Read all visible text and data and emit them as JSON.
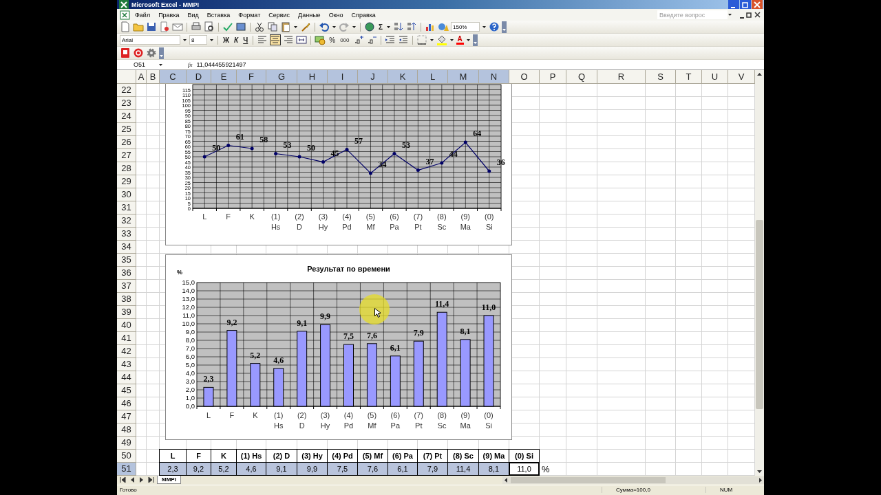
{
  "window": {
    "title": "Microsoft Excel - MMPI"
  },
  "menu": [
    "Файл",
    "Правка",
    "Вид",
    "Вставка",
    "Формат",
    "Сервис",
    "Данные",
    "Окно",
    "Справка"
  ],
  "help_search": {
    "placeholder": "Введите вопрос"
  },
  "toolbar": {
    "sum": "Σ",
    "zoom": "150%",
    "font": "Arial",
    "font_size": "8",
    "bold": "Ж",
    "italic": "К",
    "underline": "Ч",
    "percent": "%",
    "thousands": "000",
    "font_color": "A"
  },
  "formula_bar": {
    "cell": "O51",
    "fx": "fx",
    "value": "11,044455921497"
  },
  "columns": [
    {
      "label": "A",
      "highlighted": false
    },
    {
      "label": "B",
      "highlighted": false
    },
    {
      "label": "C",
      "highlighted": true
    },
    {
      "label": "D",
      "highlighted": true
    },
    {
      "label": "E",
      "highlighted": true
    },
    {
      "label": "F",
      "highlighted": true
    },
    {
      "label": "G",
      "highlighted": true
    },
    {
      "label": "H",
      "highlighted": true
    },
    {
      "label": "I",
      "highlighted": true
    },
    {
      "label": "J",
      "highlighted": true
    },
    {
      "label": "K",
      "highlighted": true
    },
    {
      "label": "L",
      "highlighted": true
    },
    {
      "label": "M",
      "highlighted": true
    },
    {
      "label": "N",
      "highlighted": true
    },
    {
      "label": "O",
      "highlighted": false
    },
    {
      "label": "P",
      "highlighted": false
    },
    {
      "label": "Q",
      "highlighted": false
    },
    {
      "label": "R",
      "highlighted": false
    },
    {
      "label": "S",
      "highlighted": false
    },
    {
      "label": "T",
      "highlighted": false
    },
    {
      "label": "U",
      "highlighted": false
    },
    {
      "label": "V",
      "highlighted": false
    }
  ],
  "rows": [
    {
      "label": "22",
      "highlighted": false
    },
    {
      "label": "23",
      "highlighted": false
    },
    {
      "label": "24",
      "highlighted": false
    },
    {
      "label": "25",
      "highlighted": false
    },
    {
      "label": "26",
      "highlighted": false
    },
    {
      "label": "27",
      "highlighted": false
    },
    {
      "label": "28",
      "highlighted": false
    },
    {
      "label": "29",
      "highlighted": false
    },
    {
      "label": "30",
      "highlighted": false
    },
    {
      "label": "31",
      "highlighted": false
    },
    {
      "label": "32",
      "highlighted": false
    },
    {
      "label": "33",
      "highlighted": false
    },
    {
      "label": "34",
      "highlighted": false
    },
    {
      "label": "35",
      "highlighted": false
    },
    {
      "label": "36",
      "highlighted": false
    },
    {
      "label": "37",
      "highlighted": false
    },
    {
      "label": "38",
      "highlighted": false
    },
    {
      "label": "39",
      "highlighted": false
    },
    {
      "label": "40",
      "highlighted": false
    },
    {
      "label": "41",
      "highlighted": false
    },
    {
      "label": "42",
      "highlighted": false
    },
    {
      "label": "43",
      "highlighted": false
    },
    {
      "label": "44",
      "highlighted": false
    },
    {
      "label": "45",
      "highlighted": false
    },
    {
      "label": "46",
      "highlighted": false
    },
    {
      "label": "47",
      "highlighted": false
    },
    {
      "label": "48",
      "highlighted": false
    },
    {
      "label": "49",
      "highlighted": false
    },
    {
      "label": "50",
      "highlighted": false
    },
    {
      "label": "51",
      "highlighted": true
    }
  ],
  "charts": [
    {
      "chart_data": {
        "type": "line",
        "categories": [
          "L",
          "F",
          "K",
          "(1) Hs",
          "(2) D",
          "(3) Hy",
          "(4) Pd",
          "(5) Mf",
          "(6) Pa",
          "(7) Pt",
          "(8) Sc",
          "(9) Ma",
          "(0) Si"
        ],
        "series": [
          {
            "color": "#000066",
            "values": [
              50,
              61,
              58,
              null,
              null,
              null,
              null,
              null,
              null,
              null,
              null,
              null,
              null
            ]
          },
          {
            "color": "#000066",
            "values": [
              null,
              null,
              null,
              53,
              50,
              45,
              57,
              34,
              53,
              37,
              44,
              64,
              36
            ]
          }
        ],
        "ylim": [
          0,
          120
        ],
        "grid": true,
        "yticks": [
          0,
          5,
          10,
          15,
          20,
          25,
          30,
          35,
          40,
          45,
          50,
          55,
          60,
          65,
          70,
          75,
          80,
          85,
          90,
          95,
          100,
          105,
          110,
          115
        ],
        "value_labels": [
          "50",
          "61",
          "58",
          "53",
          "50",
          "45",
          "57",
          "34",
          "53",
          "37",
          "44",
          "64",
          "36"
        ]
      }
    },
    {
      "chart_data": {
        "type": "bar",
        "title": "Результат по времени",
        "ylabel": "%",
        "categories": [
          "L",
          "F",
          "K",
          "(1) Hs",
          "(2) D",
          "(3) Hy",
          "(4) Pd",
          "(5) Mf",
          "(6) Pa",
          "(7) Pt",
          "(8) Sc",
          "(9) Ma",
          "(0) Si"
        ],
        "series": [
          {
            "color": "#9999ff",
            "values": [
              2.3,
              9.2,
              5.2,
              4.6,
              9.1,
              9.9,
              7.5,
              7.6,
              6.1,
              7.9,
              11.4,
              8.1,
              11.0
            ]
          }
        ],
        "ylim": [
          0,
          15
        ],
        "grid": true,
        "yticks": [
          {
            "value": 0,
            "label": "0,0"
          },
          {
            "value": 1,
            "label": "1,0"
          },
          {
            "value": 2,
            "label": "2,0"
          },
          {
            "value": 3,
            "label": "3,0"
          },
          {
            "value": 4,
            "label": "4,0"
          },
          {
            "value": 5,
            "label": "5,0"
          },
          {
            "value": 6,
            "label": "6,0"
          },
          {
            "value": 7,
            "label": "7,0"
          },
          {
            "value": 8,
            "label": "8,0"
          },
          {
            "value": 9,
            "label": "9,0"
          },
          {
            "value": 10,
            "label": "10,0"
          },
          {
            "value": 11,
            "label": "11,0"
          },
          {
            "value": 12,
            "label": "12,0"
          },
          {
            "value": 13,
            "label": "13,0"
          },
          {
            "value": 14,
            "label": "14,0"
          },
          {
            "value": 15,
            "label": "15,0"
          }
        ],
        "value_labels": [
          "2,3",
          "9,2",
          "5,2",
          "4,6",
          "9,1",
          "9,9",
          "7,5",
          "7,6",
          "6,1",
          "7,9",
          "11,4",
          "8,1",
          "11,0"
        ]
      }
    }
  ],
  "table": {
    "headers": [
      "L",
      "F",
      "K",
      "(1) Hs",
      "(2) D",
      "(3) Hy",
      "(4) Pd",
      "(5) Mf",
      "(6) Pa",
      "(7) Pt",
      "(8) Sc",
      "(9) Ma",
      "(0) Si"
    ],
    "values": [
      {
        "text": "2,3",
        "selected": true,
        "active": false
      },
      {
        "text": "9,2",
        "selected": true,
        "active": false
      },
      {
        "text": "5,2",
        "selected": true,
        "active": false
      },
      {
        "text": "4,6",
        "selected": true,
        "active": false
      },
      {
        "text": "9,1",
        "selected": true,
        "active": false
      },
      {
        "text": "9,9",
        "selected": true,
        "active": false
      },
      {
        "text": "7,5",
        "selected": true,
        "active": false
      },
      {
        "text": "7,6",
        "selected": true,
        "active": false
      },
      {
        "text": "6,1",
        "selected": true,
        "active": false
      },
      {
        "text": "7,9",
        "selected": true,
        "active": false
      },
      {
        "text": "11,4",
        "selected": true,
        "active": false
      },
      {
        "text": "8,1",
        "selected": true,
        "active": false
      },
      {
        "text": "11,0",
        "selected": false,
        "active": true
      }
    ],
    "unit": "%"
  },
  "sheet_tabs": [
    {
      "label": "MMPI",
      "selected": true
    }
  ],
  "status_bar": {
    "state": "Готово",
    "sum": "Сумма=100,0",
    "mode": "NUM"
  }
}
